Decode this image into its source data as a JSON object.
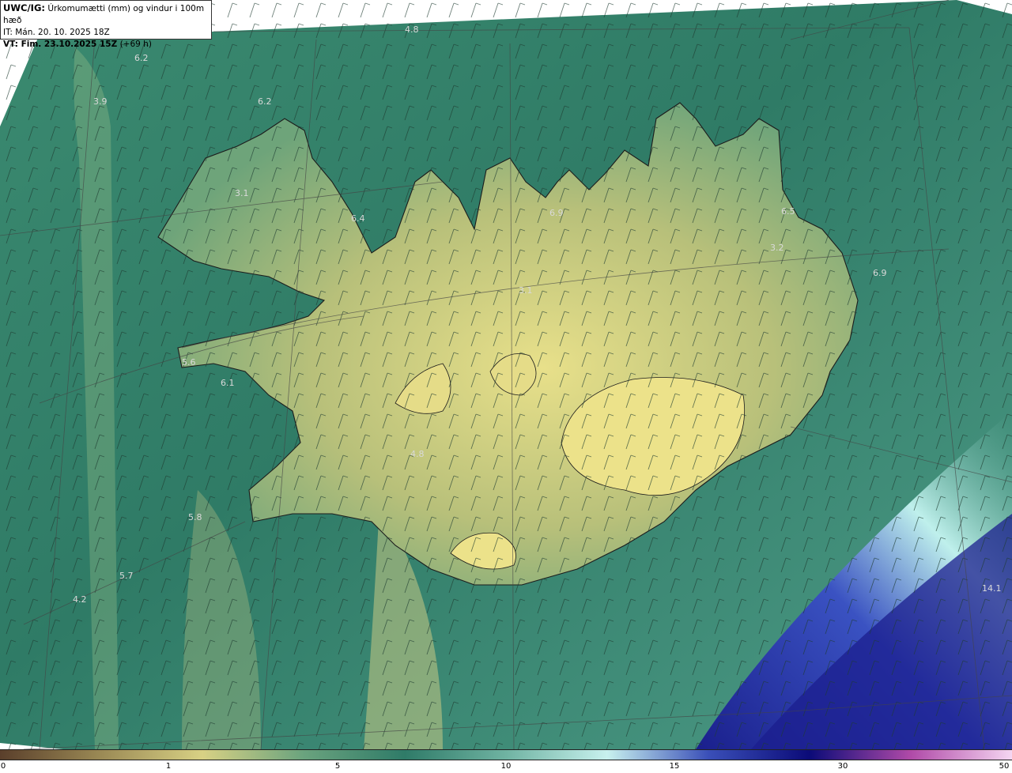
{
  "header": {
    "model": "UWC/IG:",
    "title": "Úrkomumætti (mm) og vindur i 100m hæð",
    "init_time": "IT: Mán. 20. 10. 2025 18Z",
    "valid_label": "VT: Fim. 23.10.2025 15Z",
    "valid_offset": "(+69 h)"
  },
  "map_labels": [
    "4.8",
    "6.2",
    "3.9",
    "6.2",
    "3.1",
    "6.4",
    "6.9",
    "6.5",
    "3.2",
    "6.9",
    "3.1",
    "5.6",
    "6.1",
    "4.8",
    "5.8",
    "5.7",
    "4.2",
    "14.1"
  ],
  "colorbar": {
    "ticks": [
      "0",
      "1",
      "5",
      "10",
      "15",
      "30",
      "50"
    ],
    "colors": [
      "#5a3f2b",
      "#9b8a55",
      "#d8d184",
      "#6aa37e",
      "#2f7b68",
      "#6fb3a2",
      "#c8f1ee",
      "#3a4fb8",
      "#0b0b78",
      "#b04aa8",
      "#f5d6f2"
    ]
  },
  "colors": {
    "ocean": "#2f7b68",
    "land_dry": "#e6df86",
    "heavy_precip": "#13168a",
    "coast": "#1c1c1c"
  }
}
